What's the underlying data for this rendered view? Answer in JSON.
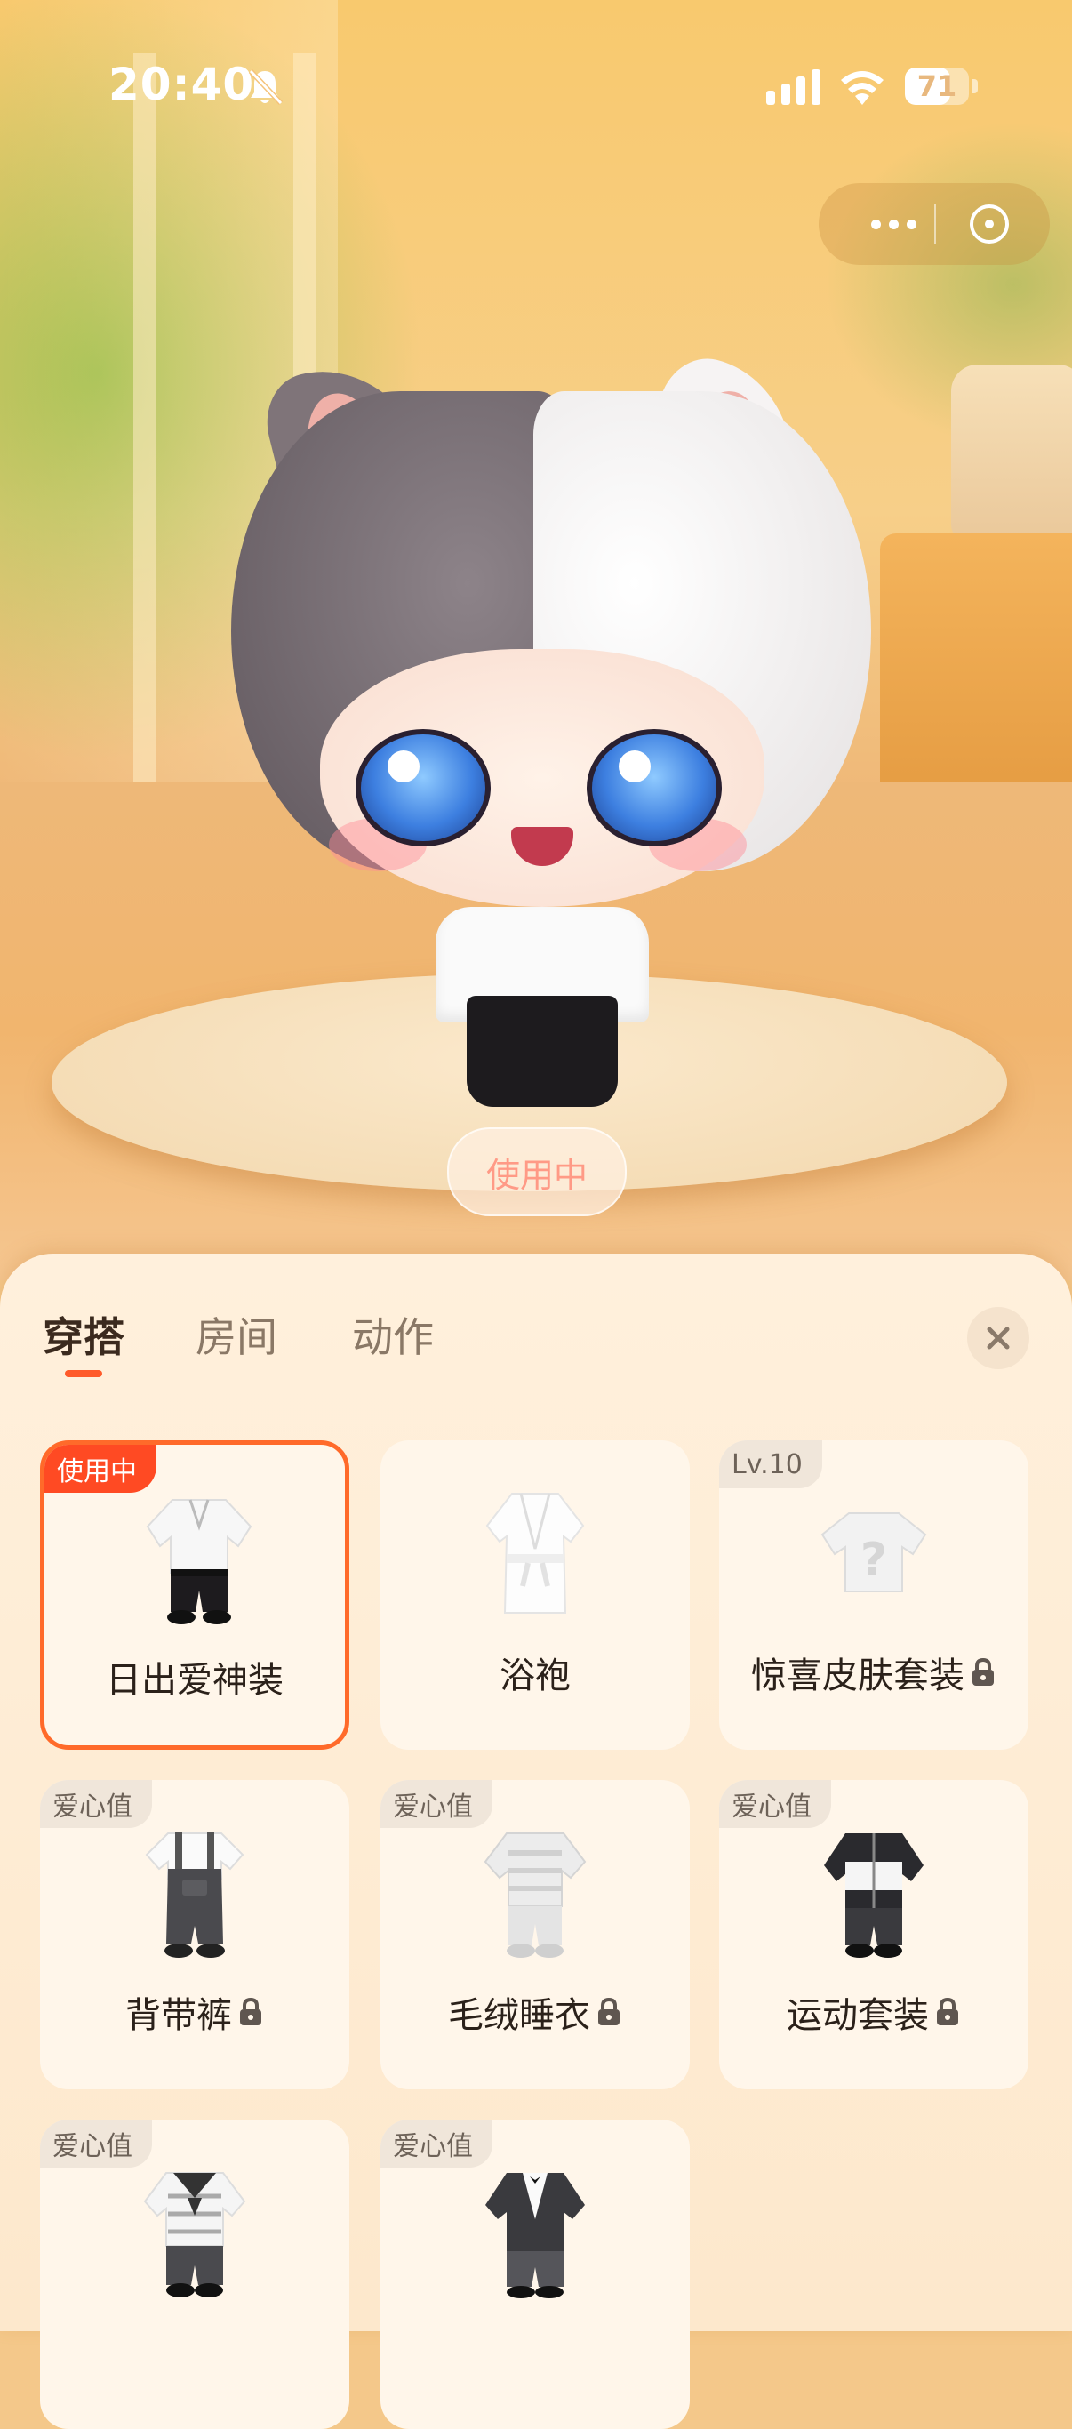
{
  "status_bar": {
    "time": "20:40",
    "battery": "71",
    "battery_level": 0.71
  },
  "capsule": {
    "more_icon": "more-dots-icon",
    "close_icon": "close-circle-icon"
  },
  "scene": {
    "in_use_chip": "使用中"
  },
  "tabs": [
    {
      "label": "穿搭",
      "active": true
    },
    {
      "label": "房间",
      "active": false
    },
    {
      "label": "动作",
      "active": false
    }
  ],
  "sheet_close_icon": "close-icon",
  "outfits": [
    {
      "name": "日出爱神装",
      "badge": "使用中",
      "badge_type": "use",
      "locked": false,
      "selected": true
    },
    {
      "name": "浴袍",
      "badge": "",
      "badge_type": "",
      "locked": false,
      "selected": false
    },
    {
      "name": "惊喜皮肤套装",
      "badge": "Lv.10",
      "badge_type": "level",
      "locked": true,
      "selected": false
    },
    {
      "name": "背带裤",
      "badge": "爱心值",
      "badge_type": "heart",
      "locked": true,
      "selected": false
    },
    {
      "name": "毛绒睡衣",
      "badge": "爱心值",
      "badge_type": "heart",
      "locked": true,
      "selected": false
    },
    {
      "name": "运动套装",
      "badge": "爱心值",
      "badge_type": "heart",
      "locked": true,
      "selected": false
    },
    {
      "name": "",
      "badge": "爱心值",
      "badge_type": "heart",
      "locked": false,
      "selected": false
    },
    {
      "name": "",
      "badge": "爱心值",
      "badge_type": "heart",
      "locked": false,
      "selected": false
    }
  ],
  "colors": {
    "accent": "#ff5a2a",
    "selected_border": "#ff6a2a",
    "sheet_bg": "#fff0dc"
  }
}
